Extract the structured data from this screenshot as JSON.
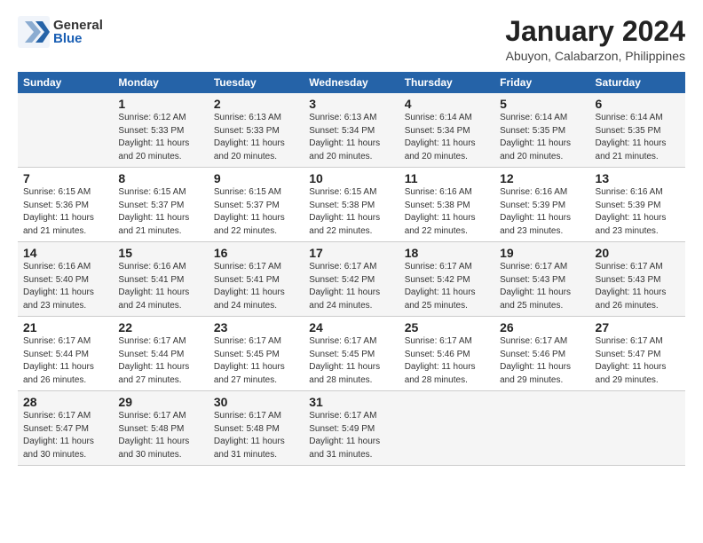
{
  "header": {
    "logo_general": "General",
    "logo_blue": "Blue",
    "title": "January 2024",
    "subtitle": "Abuyon, Calabarzon, Philippines"
  },
  "days_of_week": [
    "Sunday",
    "Monday",
    "Tuesday",
    "Wednesday",
    "Thursday",
    "Friday",
    "Saturday"
  ],
  "weeks": [
    [
      {
        "day": "",
        "sunrise": "",
        "sunset": "",
        "daylight": ""
      },
      {
        "day": "1",
        "sunrise": "Sunrise: 6:12 AM",
        "sunset": "Sunset: 5:33 PM",
        "daylight": "Daylight: 11 hours and 20 minutes."
      },
      {
        "day": "2",
        "sunrise": "Sunrise: 6:13 AM",
        "sunset": "Sunset: 5:33 PM",
        "daylight": "Daylight: 11 hours and 20 minutes."
      },
      {
        "day": "3",
        "sunrise": "Sunrise: 6:13 AM",
        "sunset": "Sunset: 5:34 PM",
        "daylight": "Daylight: 11 hours and 20 minutes."
      },
      {
        "day": "4",
        "sunrise": "Sunrise: 6:14 AM",
        "sunset": "Sunset: 5:34 PM",
        "daylight": "Daylight: 11 hours and 20 minutes."
      },
      {
        "day": "5",
        "sunrise": "Sunrise: 6:14 AM",
        "sunset": "Sunset: 5:35 PM",
        "daylight": "Daylight: 11 hours and 20 minutes."
      },
      {
        "day": "6",
        "sunrise": "Sunrise: 6:14 AM",
        "sunset": "Sunset: 5:35 PM",
        "daylight": "Daylight: 11 hours and 21 minutes."
      }
    ],
    [
      {
        "day": "7",
        "sunrise": "Sunrise: 6:15 AM",
        "sunset": "Sunset: 5:36 PM",
        "daylight": "Daylight: 11 hours and 21 minutes."
      },
      {
        "day": "8",
        "sunrise": "Sunrise: 6:15 AM",
        "sunset": "Sunset: 5:37 PM",
        "daylight": "Daylight: 11 hours and 21 minutes."
      },
      {
        "day": "9",
        "sunrise": "Sunrise: 6:15 AM",
        "sunset": "Sunset: 5:37 PM",
        "daylight": "Daylight: 11 hours and 22 minutes."
      },
      {
        "day": "10",
        "sunrise": "Sunrise: 6:15 AM",
        "sunset": "Sunset: 5:38 PM",
        "daylight": "Daylight: 11 hours and 22 minutes."
      },
      {
        "day": "11",
        "sunrise": "Sunrise: 6:16 AM",
        "sunset": "Sunset: 5:38 PM",
        "daylight": "Daylight: 11 hours and 22 minutes."
      },
      {
        "day": "12",
        "sunrise": "Sunrise: 6:16 AM",
        "sunset": "Sunset: 5:39 PM",
        "daylight": "Daylight: 11 hours and 23 minutes."
      },
      {
        "day": "13",
        "sunrise": "Sunrise: 6:16 AM",
        "sunset": "Sunset: 5:39 PM",
        "daylight": "Daylight: 11 hours and 23 minutes."
      }
    ],
    [
      {
        "day": "14",
        "sunrise": "Sunrise: 6:16 AM",
        "sunset": "Sunset: 5:40 PM",
        "daylight": "Daylight: 11 hours and 23 minutes."
      },
      {
        "day": "15",
        "sunrise": "Sunrise: 6:16 AM",
        "sunset": "Sunset: 5:41 PM",
        "daylight": "Daylight: 11 hours and 24 minutes."
      },
      {
        "day": "16",
        "sunrise": "Sunrise: 6:17 AM",
        "sunset": "Sunset: 5:41 PM",
        "daylight": "Daylight: 11 hours and 24 minutes."
      },
      {
        "day": "17",
        "sunrise": "Sunrise: 6:17 AM",
        "sunset": "Sunset: 5:42 PM",
        "daylight": "Daylight: 11 hours and 24 minutes."
      },
      {
        "day": "18",
        "sunrise": "Sunrise: 6:17 AM",
        "sunset": "Sunset: 5:42 PM",
        "daylight": "Daylight: 11 hours and 25 minutes."
      },
      {
        "day": "19",
        "sunrise": "Sunrise: 6:17 AM",
        "sunset": "Sunset: 5:43 PM",
        "daylight": "Daylight: 11 hours and 25 minutes."
      },
      {
        "day": "20",
        "sunrise": "Sunrise: 6:17 AM",
        "sunset": "Sunset: 5:43 PM",
        "daylight": "Daylight: 11 hours and 26 minutes."
      }
    ],
    [
      {
        "day": "21",
        "sunrise": "Sunrise: 6:17 AM",
        "sunset": "Sunset: 5:44 PM",
        "daylight": "Daylight: 11 hours and 26 minutes."
      },
      {
        "day": "22",
        "sunrise": "Sunrise: 6:17 AM",
        "sunset": "Sunset: 5:44 PM",
        "daylight": "Daylight: 11 hours and 27 minutes."
      },
      {
        "day": "23",
        "sunrise": "Sunrise: 6:17 AM",
        "sunset": "Sunset: 5:45 PM",
        "daylight": "Daylight: 11 hours and 27 minutes."
      },
      {
        "day": "24",
        "sunrise": "Sunrise: 6:17 AM",
        "sunset": "Sunset: 5:45 PM",
        "daylight": "Daylight: 11 hours and 28 minutes."
      },
      {
        "day": "25",
        "sunrise": "Sunrise: 6:17 AM",
        "sunset": "Sunset: 5:46 PM",
        "daylight": "Daylight: 11 hours and 28 minutes."
      },
      {
        "day": "26",
        "sunrise": "Sunrise: 6:17 AM",
        "sunset": "Sunset: 5:46 PM",
        "daylight": "Daylight: 11 hours and 29 minutes."
      },
      {
        "day": "27",
        "sunrise": "Sunrise: 6:17 AM",
        "sunset": "Sunset: 5:47 PM",
        "daylight": "Daylight: 11 hours and 29 minutes."
      }
    ],
    [
      {
        "day": "28",
        "sunrise": "Sunrise: 6:17 AM",
        "sunset": "Sunset: 5:47 PM",
        "daylight": "Daylight: 11 hours and 30 minutes."
      },
      {
        "day": "29",
        "sunrise": "Sunrise: 6:17 AM",
        "sunset": "Sunset: 5:48 PM",
        "daylight": "Daylight: 11 hours and 30 minutes."
      },
      {
        "day": "30",
        "sunrise": "Sunrise: 6:17 AM",
        "sunset": "Sunset: 5:48 PM",
        "daylight": "Daylight: 11 hours and 31 minutes."
      },
      {
        "day": "31",
        "sunrise": "Sunrise: 6:17 AM",
        "sunset": "Sunset: 5:49 PM",
        "daylight": "Daylight: 11 hours and 31 minutes."
      },
      {
        "day": "",
        "sunrise": "",
        "sunset": "",
        "daylight": ""
      },
      {
        "day": "",
        "sunrise": "",
        "sunset": "",
        "daylight": ""
      },
      {
        "day": "",
        "sunrise": "",
        "sunset": "",
        "daylight": ""
      }
    ]
  ]
}
